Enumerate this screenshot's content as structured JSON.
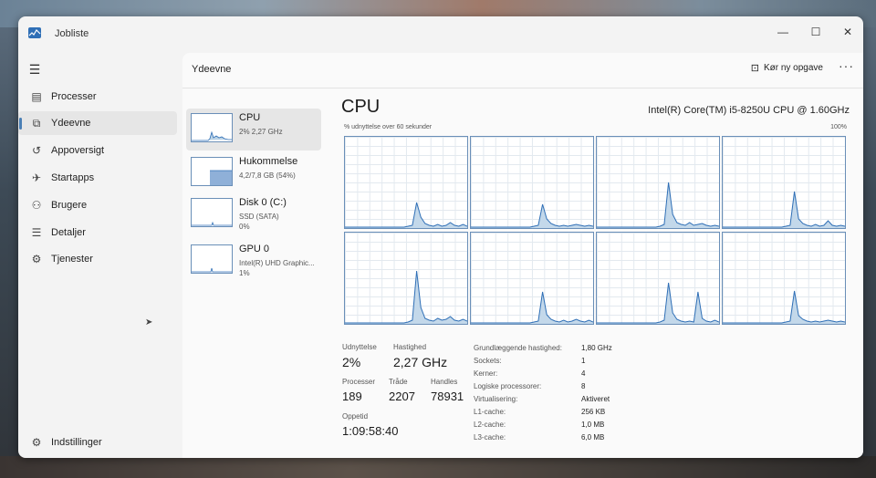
{
  "window": {
    "title": "Jobliste",
    "minimize": "—",
    "maximize": "☐",
    "close": "✕"
  },
  "nav": {
    "menu_icon": "hamburger-icon",
    "items": [
      {
        "label": "Processer",
        "icon": "processes-icon",
        "glyph": "▤"
      },
      {
        "label": "Ydeevne",
        "icon": "performance-icon",
        "glyph": "⧉"
      },
      {
        "label": "Appoversigt",
        "icon": "app-history-icon",
        "glyph": "↺"
      },
      {
        "label": "Startapps",
        "icon": "startup-apps-icon",
        "glyph": "✈"
      },
      {
        "label": "Brugere",
        "icon": "users-icon",
        "glyph": "⚇"
      },
      {
        "label": "Detaljer",
        "icon": "details-icon",
        "glyph": "☰"
      },
      {
        "label": "Tjenester",
        "icon": "services-icon",
        "glyph": "⚙"
      }
    ],
    "settings": {
      "label": "Indstillinger",
      "icon": "settings-icon",
      "glyph": "⚙"
    }
  },
  "header": {
    "title": "Ydeevne",
    "run_task_label": "Kør ny opgave",
    "more": "···"
  },
  "resources": [
    {
      "name": "CPU",
      "sub": [
        "2% 2,27 GHz"
      ]
    },
    {
      "name": "Hukommelse",
      "sub": [
        "4,2/7,8 GB (54%)"
      ]
    },
    {
      "name": "Disk 0 (C:)",
      "sub": [
        "SSD (SATA)",
        "0%"
      ]
    },
    {
      "name": "GPU 0",
      "sub": [
        "Intel(R) UHD Graphic...",
        "1%"
      ]
    }
  ],
  "cpu": {
    "title": "CPU",
    "model": "Intel(R) Core(TM) i5-8250U CPU @ 1.60GHz",
    "util_caption": "% udnyttelse over 60 sekunder",
    "max_label": "100%",
    "stats": {
      "utilization_label": "Udnyttelse",
      "utilization": "2%",
      "speed_label": "Hastighed",
      "speed": "2,27 GHz",
      "processes_label": "Processer",
      "processes": "189",
      "threads_label": "Tråde",
      "threads": "2207",
      "handles_label": "Handles",
      "handles": "78931",
      "uptime_label": "Oppetid",
      "uptime": "1:09:58:40"
    },
    "details": [
      {
        "key": "Grundlæggende hastighed:",
        "value": "1,80 GHz"
      },
      {
        "key": "Sockets:",
        "value": "1"
      },
      {
        "key": "Kerner:",
        "value": "4"
      },
      {
        "key": "Logiske processorer:",
        "value": "8"
      },
      {
        "key": "Virtualisering:",
        "value": "Aktiveret"
      },
      {
        "key": "L1-cache:",
        "value": "256 KB"
      },
      {
        "key": "L2-cache:",
        "value": "1,0 MB"
      },
      {
        "key": "L3-cache:",
        "value": "6,0 MB"
      }
    ]
  },
  "chart_data": {
    "type": "area",
    "ylim": [
      0,
      100
    ],
    "x_unit": "seconds (60 s window)",
    "series": [
      {
        "values": [
          1,
          1,
          1,
          1,
          1,
          1,
          1,
          1,
          1,
          1,
          1,
          1,
          1,
          1,
          1,
          2,
          3,
          28,
          12,
          5,
          3,
          2,
          4,
          2,
          3,
          6,
          3,
          2,
          4,
          2
        ]
      },
      {
        "values": [
          1,
          1,
          1,
          1,
          1,
          1,
          1,
          1,
          1,
          1,
          1,
          1,
          1,
          1,
          1,
          2,
          3,
          26,
          10,
          5,
          3,
          2,
          3,
          2,
          3,
          4,
          3,
          2,
          3,
          2
        ]
      },
      {
        "values": [
          1,
          1,
          1,
          1,
          1,
          1,
          1,
          1,
          1,
          1,
          1,
          1,
          1,
          1,
          1,
          2,
          4,
          50,
          15,
          6,
          4,
          3,
          6,
          3,
          4,
          5,
          3,
          2,
          3,
          2
        ]
      },
      {
        "values": [
          1,
          1,
          1,
          1,
          1,
          1,
          1,
          1,
          1,
          1,
          1,
          1,
          1,
          1,
          1,
          2,
          3,
          40,
          10,
          5,
          3,
          2,
          4,
          2,
          3,
          8,
          3,
          2,
          3,
          2
        ]
      },
      {
        "values": [
          1,
          1,
          1,
          1,
          1,
          1,
          1,
          1,
          1,
          1,
          1,
          1,
          1,
          1,
          1,
          2,
          4,
          58,
          18,
          6,
          4,
          3,
          6,
          4,
          5,
          8,
          4,
          3,
          5,
          3
        ]
      },
      {
        "values": [
          1,
          1,
          1,
          1,
          1,
          1,
          1,
          1,
          1,
          1,
          1,
          1,
          1,
          1,
          1,
          2,
          3,
          35,
          10,
          5,
          3,
          2,
          4,
          2,
          3,
          5,
          3,
          2,
          4,
          2
        ]
      },
      {
        "values": [
          1,
          1,
          1,
          1,
          1,
          1,
          1,
          1,
          1,
          1,
          1,
          1,
          1,
          1,
          1,
          2,
          4,
          45,
          12,
          5,
          3,
          2,
          3,
          2,
          35,
          6,
          3,
          2,
          4,
          2
        ]
      },
      {
        "values": [
          1,
          1,
          1,
          1,
          1,
          1,
          1,
          1,
          1,
          1,
          1,
          1,
          1,
          1,
          1,
          2,
          3,
          36,
          9,
          5,
          3,
          2,
          3,
          2,
          3,
          4,
          3,
          2,
          3,
          2
        ]
      }
    ]
  }
}
